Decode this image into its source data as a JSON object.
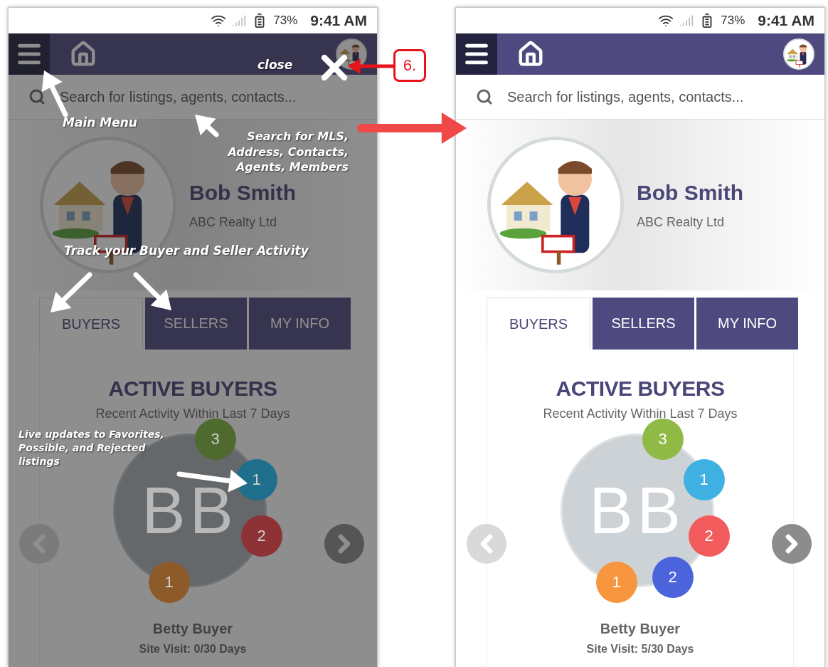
{
  "phones": [
    {
      "tutorial_overlay": true,
      "status": {
        "battery": "73%",
        "time": "9:41 AM"
      },
      "search": {
        "placeholder": "Search for listings, agents, contacts..."
      },
      "profile": {
        "name": "Bob Smith",
        "company": "ABC Realty Ltd"
      },
      "tabs": [
        {
          "label": "BUYERS",
          "selected": true
        },
        {
          "label": "SELLERS",
          "selected": false
        },
        {
          "label": "MY INFO",
          "selected": false
        }
      ],
      "section": {
        "title": "ACTIVE BUYERS",
        "subtitle": "Recent Activity Within Last 7 Days"
      },
      "buyer": {
        "initials": "BB",
        "name": "Betty Buyer",
        "visits": "Site Visit: 0/30 Days",
        "badges": [
          {
            "count": "3",
            "color": "#4e6a2e"
          },
          {
            "count": "1",
            "color": "#1f6f8c"
          },
          {
            "count": "2",
            "color": "#8f3236"
          },
          {
            "count": "1",
            "color": "#8d5a2a"
          }
        ]
      },
      "annotations": [
        {
          "kind": "close",
          "lines": [
            "close"
          ]
        },
        {
          "kind": "menu",
          "lines": [
            "Main Menu"
          ]
        },
        {
          "kind": "search",
          "lines": [
            "Search for MLS,",
            "Address, Contacts,",
            "Agents, Members"
          ]
        },
        {
          "kind": "track",
          "lines": [
            "Track your Buyer and Seller Activity"
          ]
        },
        {
          "kind": "live",
          "lines": [
            "Live updates to Favorites,",
            "Possible, and Rejected",
            "listings"
          ]
        }
      ]
    },
    {
      "tutorial_overlay": false,
      "status": {
        "battery": "73%",
        "time": "9:41 AM"
      },
      "search": {
        "placeholder": "Search for listings, agents, contacts..."
      },
      "profile": {
        "name": "Bob Smith",
        "company": "ABC Realty Ltd"
      },
      "tabs": [
        {
          "label": "BUYERS",
          "selected": true
        },
        {
          "label": "SELLERS",
          "selected": false
        },
        {
          "label": "MY INFO",
          "selected": false
        }
      ],
      "section": {
        "title": "ACTIVE BUYERS",
        "subtitle": "Recent Activity Within Last 7 Days"
      },
      "buyer": {
        "initials": "BB",
        "name": "Betty Buyer",
        "visits": "Site Visit: 5/30 Days",
        "badges": [
          {
            "count": "3",
            "color": "#8fba45"
          },
          {
            "count": "1",
            "color": "#3fb0e2"
          },
          {
            "count": "2",
            "color": "#f25c5c"
          },
          {
            "count": "1",
            "color": "#f7963e"
          },
          {
            "count": "2",
            "color": "#4c64db"
          }
        ]
      }
    }
  ],
  "callout": {
    "label": "6."
  }
}
